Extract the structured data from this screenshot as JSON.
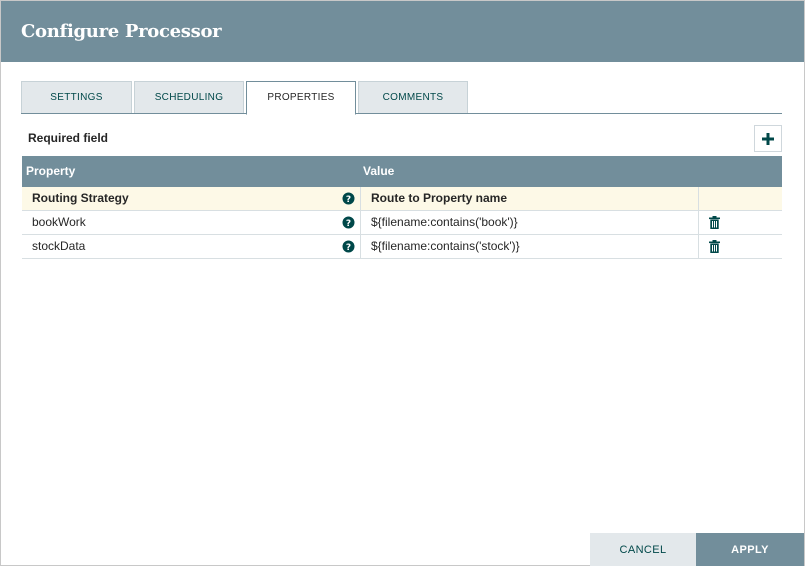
{
  "dialog": {
    "title": "Configure Processor"
  },
  "tabs": [
    {
      "label": "SETTINGS",
      "active": false
    },
    {
      "label": "SCHEDULING",
      "active": false
    },
    {
      "label": "PROPERTIES",
      "active": true
    },
    {
      "label": "COMMENTS",
      "active": false
    }
  ],
  "properties_panel": {
    "required_label": "Required field",
    "add_icon": "plus-icon",
    "columns": {
      "property": "Property",
      "value": "Value"
    },
    "rows": [
      {
        "property": "Routing Strategy",
        "value": "Route to Property name",
        "required": true,
        "help_icon": "question-circle-icon",
        "deletable": false
      },
      {
        "property": "bookWork",
        "value": "${filename:contains('book')}",
        "required": false,
        "help_icon": "question-circle-icon",
        "deletable": true,
        "delete_icon": "trash-icon"
      },
      {
        "property": "stockData",
        "value": "${filename:contains('stock')}",
        "required": false,
        "help_icon": "question-circle-icon",
        "deletable": true,
        "delete_icon": "trash-icon"
      }
    ]
  },
  "footer": {
    "cancel_label": "CANCEL",
    "apply_label": "APPLY"
  },
  "colors": {
    "header": "#728e9b",
    "accent_dark": "#004849",
    "highlight_row": "#fdf9e7",
    "tab_inactive": "#e3e8eb"
  }
}
